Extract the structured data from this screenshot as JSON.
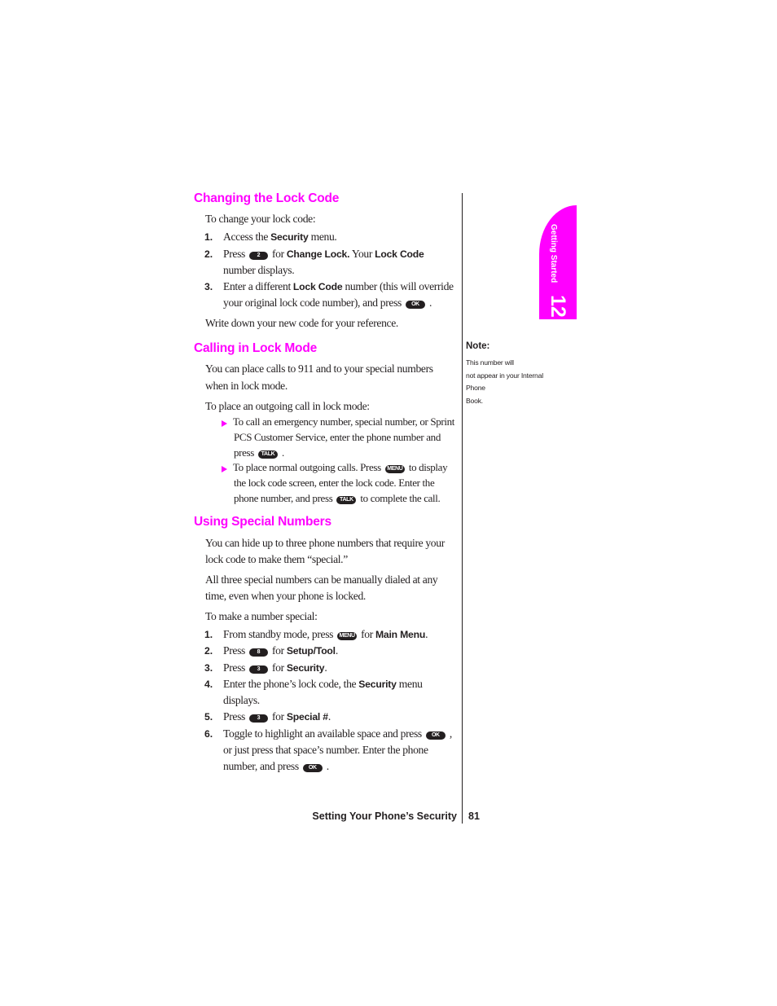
{
  "side_tab": {
    "label": "Getting Started",
    "number": "12",
    "color": "#ff00ff"
  },
  "accent_color": "#ff00ff",
  "sections": {
    "changing": {
      "heading": "Changing the Lock Code",
      "intro": "To change your lock code:",
      "steps": [
        {
          "num": "1.",
          "t1": "Access the ",
          "b1": "Security",
          "t2": " menu."
        },
        {
          "num": "2.",
          "t1": "Press",
          "key": "2",
          "t2": "for ",
          "b1": "Change Lock.",
          "t3": " Your ",
          "b2": "Lock Code",
          "line2": "number displays."
        },
        {
          "num": "3.",
          "t1": "Enter a different ",
          "b1": "Lock Code",
          "t2": " number (this will override",
          "line2": "your original lock code number), and press",
          "key": "OK",
          "end": "."
        }
      ],
      "outro": "Write down your new code for your reference."
    },
    "calling": {
      "heading": "Calling in Lock Mode",
      "para1_line1": "You can place calls to 911 and to your special numbers",
      "para1_line2": "when in lock mode.",
      "para2": "To place an outgoing call in lock mode:",
      "bullets": [
        {
          "line1": "To call an emergency number, special number, or Sprint",
          "line2": "PCS Customer Service, enter the phone number and",
          "line3": "press",
          "key": "TALK",
          "end": "."
        },
        {
          "line1a": "To place normal outgoing calls. Press",
          "key1": "MENU",
          "line1b": "to display",
          "line2": "the lock code screen, enter the lock code. Enter the",
          "line3a": "phone number, and press",
          "key2": "TALK",
          "line3b": "to complete the call."
        }
      ]
    },
    "special": {
      "heading": "Using Special Numbers",
      "para1_line1": "You can hide up to three phone numbers that require your",
      "para1_line2": "lock code to make them “special.”",
      "para2_line1": "All three special numbers can be manually dialed at any",
      "para2_line2": "time, even when your phone is locked.",
      "para3": "To make a number special:",
      "steps": [
        {
          "num": "1.",
          "t1": "From standby mode, press",
          "key": "MENU",
          "t2": "for ",
          "b1": "Main Menu",
          "end": "."
        },
        {
          "num": "2.",
          "t1": "Press",
          "key": "8",
          "t2": "for ",
          "b1": "Setup/Tool",
          "end": "."
        },
        {
          "num": "3.",
          "t1": "Press",
          "key": "3",
          "t2": "for ",
          "b1": "Security",
          "end": "."
        },
        {
          "num": "4.",
          "t1": "Enter the phone’s lock code, the ",
          "b1": "Security",
          "t2": " menu",
          "line2": "displays."
        },
        {
          "num": "5.",
          "t1": "Press",
          "key": "3",
          "t2": "for ",
          "b1": "Special #",
          "end": "."
        },
        {
          "num": "6.",
          "t1": "Toggle to highlight an available space and press",
          "key": "OK",
          "end": ",",
          "line2": "or just press that space’s number. Enter the phone",
          "line3": "number, and press",
          "key2": "OK",
          "end3": "."
        }
      ]
    }
  },
  "note": {
    "title": "Note:",
    "lines": [
      "This number will",
      "not appear in your Internal",
      "Phone",
      "Book."
    ]
  },
  "footer": {
    "title": "Setting Your Phone’s Security",
    "page": "81"
  }
}
